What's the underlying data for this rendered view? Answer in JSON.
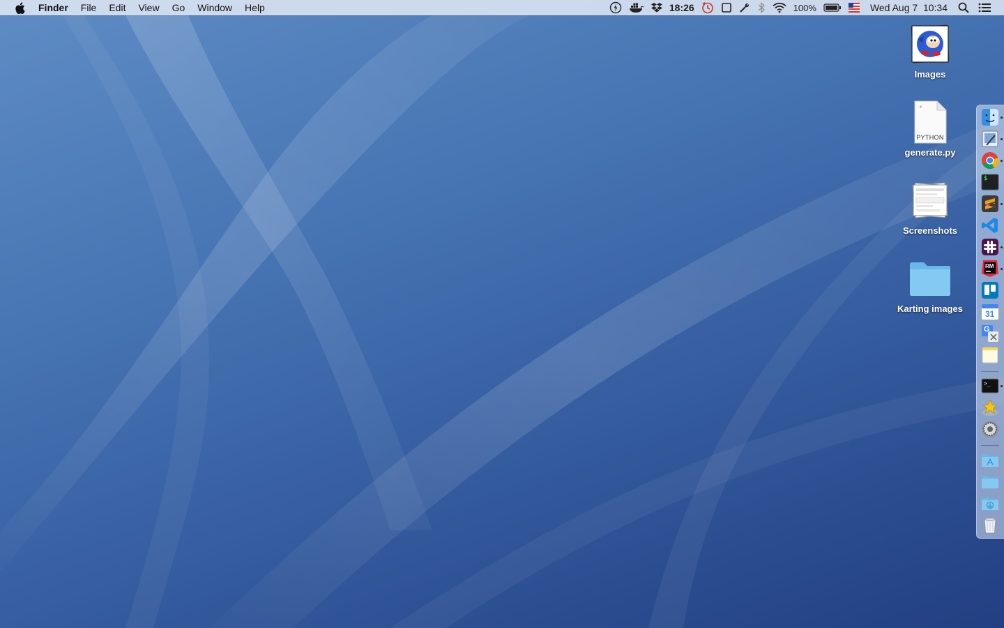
{
  "menubar": {
    "app_name": "Finder",
    "menus": [
      "File",
      "Edit",
      "View",
      "Go",
      "Window",
      "Help"
    ],
    "status": {
      "clock_timer": "18:26",
      "battery": "100%",
      "datetime": "Wed Aug 7  10:34"
    },
    "icons": [
      "apple-icon",
      "power-icon",
      "docker-icon",
      "dropbox-icon",
      "timer-icon",
      "screen-square-icon",
      "tools-icon",
      "bluetooth-icon",
      "wifi-icon",
      "battery-icon",
      "input-flag-icon",
      "spotlight-icon",
      "notification-center-icon"
    ]
  },
  "desktop": {
    "icons": [
      {
        "label": "Images",
        "icon": "image-folder-icon"
      },
      {
        "label": "generate.py",
        "icon": "python-file-icon",
        "badge": "PYTHON"
      },
      {
        "label": "Screenshots",
        "icon": "screenshots-folder-icon"
      },
      {
        "label": "Karting images",
        "icon": "folder-icon"
      }
    ]
  },
  "dock": {
    "items": [
      {
        "name": "Finder",
        "icon": "finder-icon",
        "running": true
      },
      {
        "name": "Preview",
        "icon": "preview-icon",
        "running": true
      },
      {
        "name": "Chrome",
        "icon": "chrome-icon",
        "running": true
      },
      {
        "name": "Terminal",
        "icon": "terminal-icon",
        "running": false,
        "text": "$"
      },
      {
        "name": "Sublime Text",
        "icon": "sublime-icon",
        "running": true
      },
      {
        "name": "VS Code",
        "icon": "vscode-icon",
        "running": false
      },
      {
        "name": "Slack",
        "icon": "slack-icon",
        "running": true
      },
      {
        "name": "RubyMine",
        "icon": "rubymine-icon",
        "running": true,
        "text": "RM"
      },
      {
        "name": "Trello",
        "icon": "trello-icon",
        "running": false
      },
      {
        "name": "Calendar",
        "icon": "calendar-icon",
        "running": false,
        "text": "31"
      },
      {
        "name": "Google Translate",
        "icon": "translate-icon",
        "running": false,
        "text": "G"
      },
      {
        "name": "Notes",
        "icon": "notes-icon",
        "running": false
      },
      {
        "name": "Terminal",
        "icon": "terminal2-icon",
        "running": true,
        "text": ">_"
      },
      {
        "name": "Star app",
        "icon": "star-icon",
        "running": false
      },
      {
        "name": "System Preferences",
        "icon": "system-preferences-icon",
        "running": false
      },
      {
        "name": "Applications",
        "icon": "applications-folder-icon",
        "running": false
      },
      {
        "name": "Documents",
        "icon": "documents-folder-icon",
        "running": false
      },
      {
        "name": "Downloads",
        "icon": "downloads-folder-icon",
        "running": false
      },
      {
        "name": "Trash",
        "icon": "trash-icon",
        "running": false
      }
    ]
  },
  "colors": {
    "wallpaper_top": "#5f8cc4",
    "wallpaper_bottom": "#223f82",
    "folder_blue": "#7cc4ee",
    "menubar_bg": "#dee6f2"
  }
}
